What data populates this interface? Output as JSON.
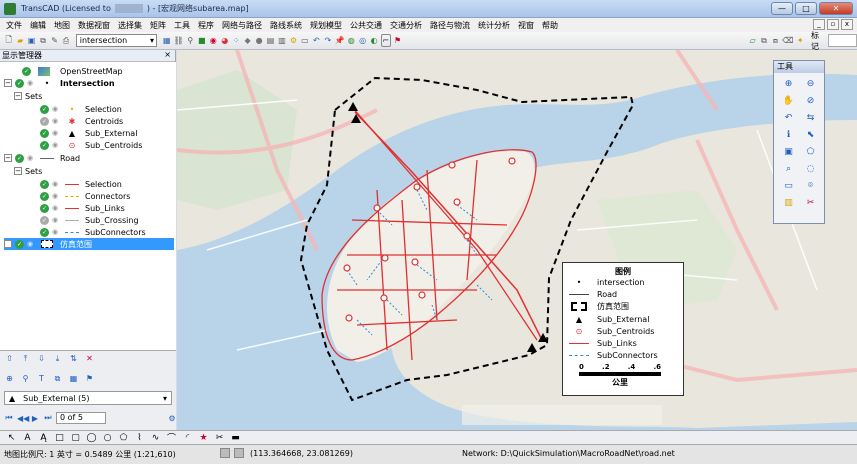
{
  "window": {
    "title_prefix": "TransCAD (Licensed to",
    "title_suffix": ") - [宏观网络subarea.map]",
    "min": "—",
    "max": "□",
    "close": "✕"
  },
  "menu": [
    "文件",
    "编辑",
    "地图",
    "数据视窗",
    "选择集",
    "矩阵",
    "工具",
    "程序",
    "网络与路径",
    "路线系统",
    "规划模型",
    "公共交通",
    "交通分析",
    "路径与物流",
    "统计分析",
    "视窗",
    "帮助"
  ],
  "toolbar": {
    "layer_value": "intersection",
    "label_text": "标记"
  },
  "display_manager": {
    "title": "显示管理器",
    "close": "×",
    "rows": [
      {
        "label": "OpenStreetMap",
        "bold": false
      },
      {
        "label": "Intersection",
        "bold": true
      },
      {
        "label": "Sets",
        "bold": false
      },
      {
        "label": "Selection",
        "bold": false
      },
      {
        "label": "Centroids",
        "bold": false
      },
      {
        "label": "Sub_External",
        "bold": false
      },
      {
        "label": "Sub_Centroids",
        "bold": false
      },
      {
        "label": "Road",
        "bold": false
      },
      {
        "label": "Sets",
        "bold": false
      },
      {
        "label": "Selection",
        "bold": false
      },
      {
        "label": "Connectors",
        "bold": false
      },
      {
        "label": "Sub_Links",
        "bold": false
      },
      {
        "label": "Sub_Crossing",
        "bold": false
      },
      {
        "label": "SubConnectors",
        "bold": false
      },
      {
        "label": "仿真范围",
        "bold": false
      }
    ],
    "selected_layer": "Sub_External (5)",
    "record_count": "0 of 5"
  },
  "map_labels": {
    "river_label": "",
    "tool_palette_title": "工具"
  },
  "legend": {
    "title": "图例",
    "items": [
      "intersection",
      "Road",
      "仿真范围",
      "Sub_External",
      "Sub_Centroids",
      "Sub_Links",
      "SubConnectors"
    ],
    "scale_ticks": [
      "0",
      ".2",
      ".4",
      ".6"
    ],
    "scale_unit": "公里"
  },
  "status": {
    "scale": "地图比例尺: 1 英寸 = 0.5489 公里 (1:21,610)",
    "coords": "(113.364668, 23.081269)",
    "network": "Network: D:\\QuickSimulation\\MacroRoadNet\\road.net"
  },
  "colors": {
    "link": "#e03030",
    "connector": "#2a8fd6",
    "boundary": "#000000",
    "selection_highlight": "#3399ff"
  }
}
